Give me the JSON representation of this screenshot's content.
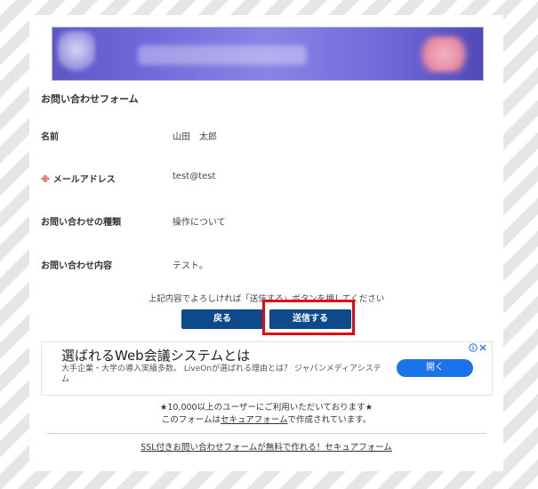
{
  "form": {
    "title": "お問い合わせフォーム",
    "fields": [
      {
        "label": "名前",
        "value": "山田　太郎",
        "required": false
      },
      {
        "label": "メールアドレス",
        "value": "test@test",
        "required": true,
        "required_mark": "※"
      },
      {
        "label": "お問い合わせの種類",
        "value": "操作について",
        "required": false
      },
      {
        "label": "お問い合わせ内容",
        "value": "テスト。",
        "required": false
      }
    ],
    "notice": "上記内容でよろしければ「送信する」ボタンを押してください",
    "back_label": "戻る",
    "send_label": "送信する"
  },
  "ad": {
    "title": "選ばれるWeb会議システムとは",
    "description": "大手企業・大学の導入実績多数。 LiveOnが選ばれる理由とは？ ジャパンメディアシステム",
    "button_label": "開く",
    "info_icon": "info-icon"
  },
  "usage": {
    "line1": "★10,000以上のユーザーにご利用いただいております★",
    "line2_prefix": "このフォームは",
    "line2_link": "セキュアフォーム",
    "line2_suffix": "で作成されています。"
  },
  "footer": {
    "link": "SSL付きお問い合わせフォームが無料で作れる！セキュアフォーム"
  },
  "colors": {
    "button": "#0d4a8c",
    "highlight": "#e30613",
    "required": "#e23b3b",
    "ad_button": "#1a73e8"
  }
}
